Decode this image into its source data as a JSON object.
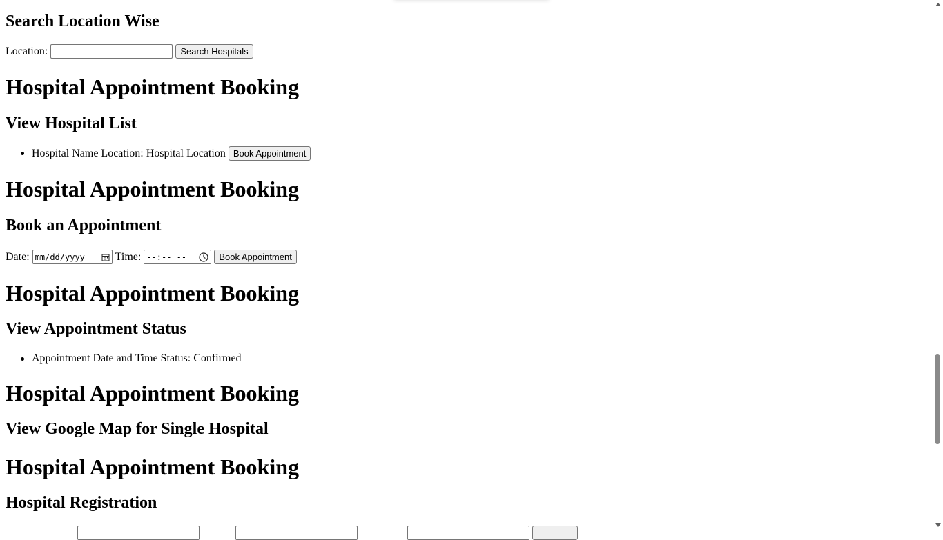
{
  "search": {
    "heading": "Search Location Wise",
    "location_label": "Location:",
    "location_value": "",
    "search_button": "Search Hospitals"
  },
  "hospital_list": {
    "page_heading": "Hospital Appointment Booking",
    "heading": "View Hospital List",
    "items": [
      {
        "text": "Hospital Name Location: Hospital Location",
        "button": "Book Appointment"
      }
    ]
  },
  "book": {
    "page_heading": "Hospital Appointment Booking",
    "heading": "Book an Appointment",
    "date_label": "Date:",
    "date_placeholder": "mm/dd/yyyy",
    "time_label": "Time:",
    "time_placeholder": "--:-- --",
    "button": "Book Appointment"
  },
  "status": {
    "page_heading": "Hospital Appointment Booking",
    "heading": "View Appointment Status",
    "items": [
      {
        "text": "Appointment Date and Time Status: Confirmed"
      }
    ]
  },
  "map": {
    "page_heading": "Hospital Appointment Booking",
    "heading": "View Google Map for Single Hospital"
  },
  "registration": {
    "page_heading": "Hospital Appointment Booking",
    "heading": "Hospital Registration"
  },
  "icons": {
    "date": "calendar-icon",
    "time": "clock-icon"
  }
}
